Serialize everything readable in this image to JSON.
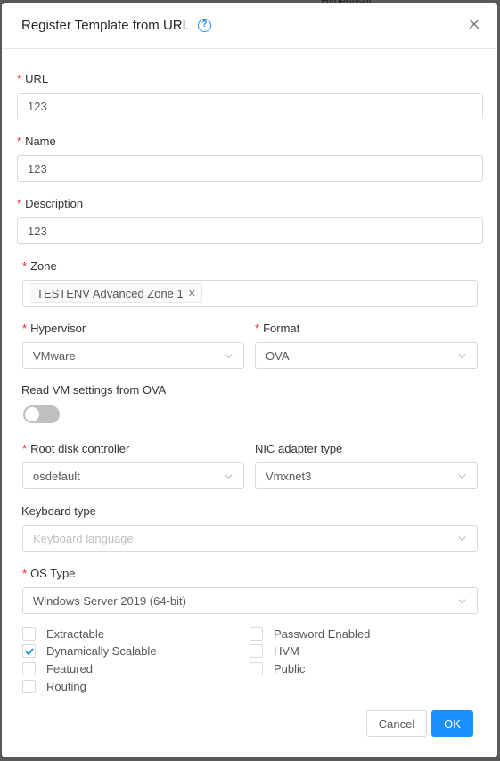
{
  "background": {
    "peek_text": "Hypervisor"
  },
  "modal": {
    "title": "Register Template from URL",
    "help_icon": "question-circle-icon",
    "close_icon": "close-icon"
  },
  "fields": {
    "url": {
      "label": "URL",
      "value": "123"
    },
    "name": {
      "label": "Name",
      "value": "123"
    },
    "description": {
      "label": "Description",
      "value": "123"
    },
    "zone": {
      "label": "Zone",
      "tags": [
        "TESTENV Advanced Zone 1"
      ]
    },
    "hypervisor": {
      "label": "Hypervisor",
      "value": "VMware"
    },
    "format": {
      "label": "Format",
      "value": "OVA"
    },
    "read_vm_settings": {
      "label": "Read VM settings from OVA",
      "on": false
    },
    "root_disk_controller": {
      "label": "Root disk controller",
      "value": "osdefault"
    },
    "nic_adapter_type": {
      "label": "NIC adapter type",
      "value": "Vmxnet3"
    },
    "keyboard_type": {
      "label": "Keyboard type",
      "placeholder": "Keyboard language"
    },
    "os_type": {
      "label": "OS Type",
      "value": "Windows Server 2019 (64-bit)"
    }
  },
  "checkboxes": {
    "extractable": {
      "label": "Extractable",
      "checked": false
    },
    "password_enabled": {
      "label": "Password Enabled",
      "checked": false
    },
    "dynamically_scalable": {
      "label": "Dynamically Scalable",
      "checked": true
    },
    "hvm": {
      "label": "HVM",
      "checked": false
    },
    "featured": {
      "label": "Featured",
      "checked": false
    },
    "public": {
      "label": "Public",
      "checked": false
    },
    "routing": {
      "label": "Routing",
      "checked": false
    }
  },
  "footer": {
    "cancel_label": "Cancel",
    "ok_label": "OK"
  },
  "colors": {
    "primary": "#1890ff",
    "required": "#f5222d",
    "border": "#d9d9d9",
    "toggle_off": "#bfbfbf"
  }
}
